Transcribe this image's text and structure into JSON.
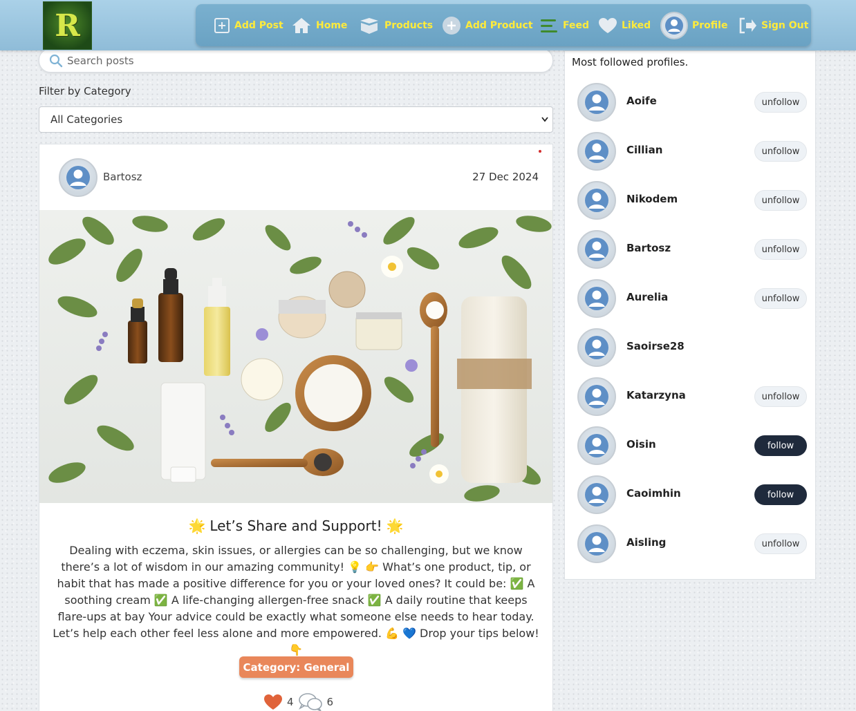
{
  "nav": {
    "logo_letter": "R",
    "items": [
      {
        "label": "Add Post",
        "icon": "plus-square-icon"
      },
      {
        "label": "Home",
        "icon": "home-icon"
      },
      {
        "label": "Products",
        "icon": "box-icon"
      },
      {
        "label": "Add Product",
        "icon": "plus-circle-icon"
      },
      {
        "label": "Feed",
        "icon": "feed-lines-icon"
      },
      {
        "label": "Liked",
        "icon": "heart-icon"
      },
      {
        "label": "Profile",
        "icon": "avatar-icon"
      },
      {
        "label": "Sign Out",
        "icon": "sign-out-icon"
      }
    ],
    "accent_color": "#ffeb3b"
  },
  "search": {
    "placeholder": "Search posts",
    "value": ""
  },
  "filter": {
    "label": "Filter by Category",
    "selected": "All Categories"
  },
  "post": {
    "author": "Bartosz",
    "date": "27 Dec 2024",
    "title": "Let’s Share and Support!",
    "title_emoji": "🌟",
    "body_parts": [
      "Dealing with eczema, skin issues, or allergies can be so challenging, but we know there’s a lot of wisdom in our amazing community!",
      "What’s one product, tip, or habit that has made a positive difference for you or your loved ones? It could be:",
      "A soothing cream",
      "A life-changing allergen-free snack",
      "A daily routine that keeps flare-ups at bay Your advice could be exactly what someone else needs to hear today. Let’s help each other feel less alone and more empowered.",
      "Drop your tips below!"
    ],
    "category": "Category: General",
    "likes": "4",
    "comments": "6",
    "like_color": "#e0633a"
  },
  "followed": {
    "title": "Most followed profiles.",
    "profiles": [
      {
        "name": "Aoife",
        "button": "unfollow"
      },
      {
        "name": "Cillian",
        "button": "unfollow"
      },
      {
        "name": "Nikodem",
        "button": "unfollow"
      },
      {
        "name": "Bartosz",
        "button": "unfollow"
      },
      {
        "name": "Aurelia",
        "button": "unfollow"
      },
      {
        "name": "Saoirse28",
        "button": ""
      },
      {
        "name": "Katarzyna",
        "button": "unfollow"
      },
      {
        "name": "Oisin",
        "button": "follow"
      },
      {
        "name": "Caoimhin",
        "button": "follow"
      },
      {
        "name": "Aisling",
        "button": "unfollow"
      }
    ]
  }
}
